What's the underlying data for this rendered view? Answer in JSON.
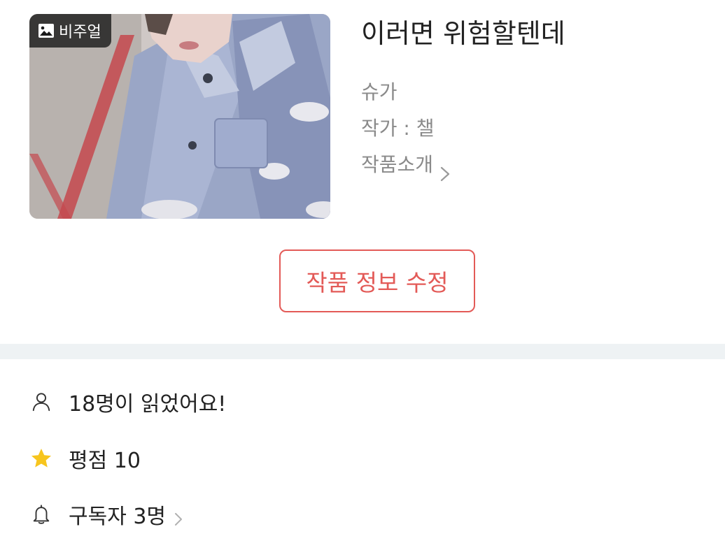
{
  "work": {
    "visual_badge": "비주얼",
    "title": "이러면 위험할텐데",
    "subtitle": "슈가",
    "author_line": "작가 : 챌",
    "intro_link": "작품소개"
  },
  "actions": {
    "edit_label": "작품 정보 수정"
  },
  "stats": {
    "readers": "18명이 읽었어요!",
    "rating": "평점 10",
    "subscribers": "구독자 3명"
  },
  "colors": {
    "accent": "#e35a57",
    "star": "#f7c51e",
    "muted_text": "#8a8a8a",
    "band": "#eef2f4"
  },
  "icons": {
    "badge": "image-icon",
    "intro": "chevron-right-icon",
    "readers": "person-icon",
    "rating": "star-icon",
    "subscribers": "bell-icon"
  }
}
